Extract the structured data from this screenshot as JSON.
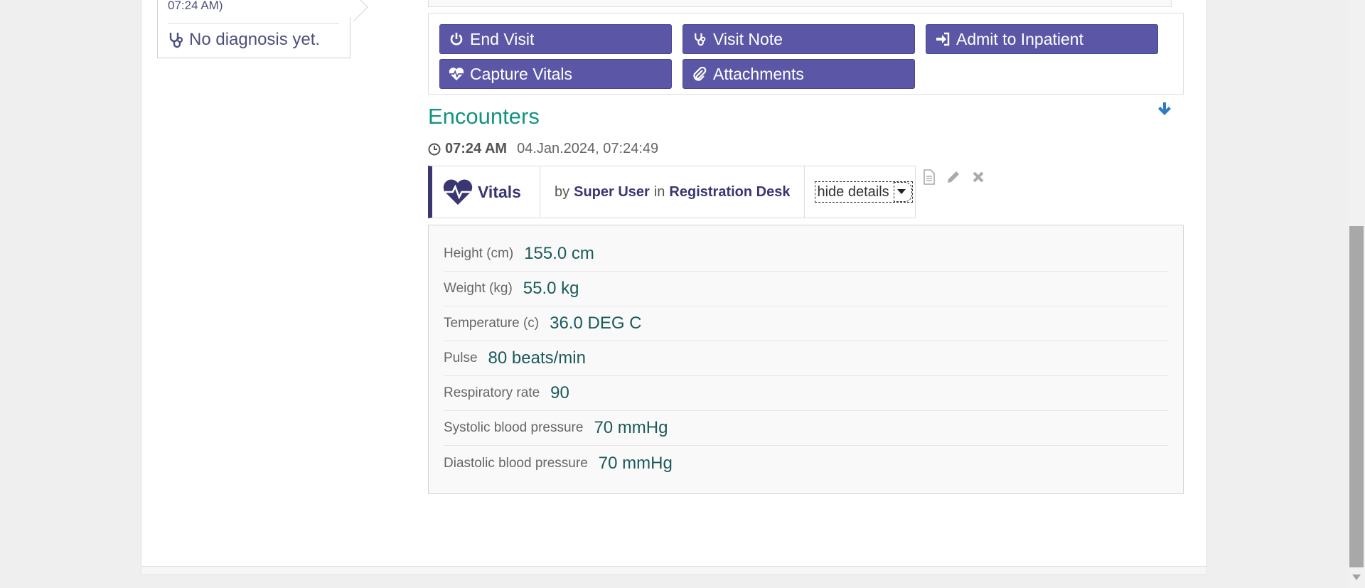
{
  "diagnosis": {
    "time_text": "07:24 AM)",
    "no_diagnosis": "No diagnosis yet."
  },
  "actions": {
    "end_visit": "End Visit",
    "visit_note": "Visit Note",
    "admit_inpatient": "Admit to Inpatient",
    "capture_vitals": "Capture Vitals",
    "attachments": "Attachments"
  },
  "encounters": {
    "title": "Encounters",
    "time": "07:24 AM",
    "datetime": "04.Jan.2024, 07:24:49",
    "type": "Vitals",
    "by_prefix": "by",
    "user": "Super User",
    "in_word": "in",
    "location": "Registration Desk",
    "hide_details": "hide details"
  },
  "vitals": [
    {
      "label": "Height (cm)",
      "value": "155.0 cm"
    },
    {
      "label": "Weight (kg)",
      "value": "55.0 kg"
    },
    {
      "label": "Temperature (c)",
      "value": "36.0 DEG C"
    },
    {
      "label": "Pulse",
      "value": "80 beats/min"
    },
    {
      "label": "Respiratory rate",
      "value": "90"
    },
    {
      "label": "Systolic blood pressure",
      "value": "70 mmHg"
    },
    {
      "label": "Diastolic blood pressure",
      "value": "70 mmHg"
    }
  ],
  "colors": {
    "button": "#5b57a6",
    "title": "#139383",
    "accent_dark": "#3a3672",
    "value_text": "#1b5a5a"
  }
}
